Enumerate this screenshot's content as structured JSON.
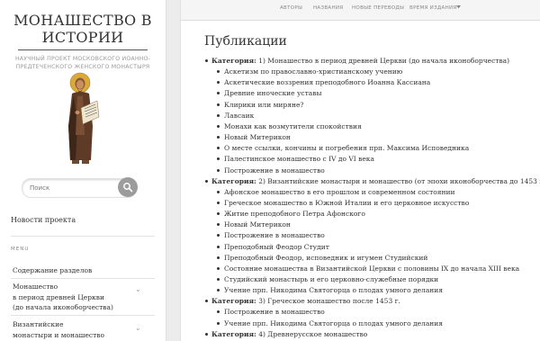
{
  "site": {
    "title_line1": "МОНАШЕСТВО В",
    "title_line2": "ИСТОРИИ",
    "description": "НАУЧНЫЙ ПРОЕКТ МОСКОВСКОГО ИОАННО-ПРЕДТЕЧЕНСКОГО ЖЕНСКОГО МОНАСТЫРЯ"
  },
  "search": {
    "placeholder": "Поиск"
  },
  "sidebar": {
    "news_link": "Новости проекта",
    "menu_label": "MENU",
    "menu_items": [
      "Содержание разделов",
      "Монашество\nв период древней Церкви\n(до начала иконоборчества)",
      "Византийские\nмонастыри и монашество"
    ]
  },
  "nav": {
    "items": [
      "АВТОРЫ",
      "НАЗВАНИЯ",
      "НОВЫЕ ПЕРЕВОДЫ",
      "ВРЕМЯ ИЗДАНИЯ"
    ],
    "dropdown_icon": "chevron-down-icon"
  },
  "page": {
    "title": "Публикации",
    "category_label": "Категория:",
    "categories": [
      {
        "name": "1) Монашество в период древней Церкви (до начала иконоборчества)",
        "items": [
          "Аскетизм по православно-христианскому учению",
          "Аскетические воззрения преподобного Иоанна Кассиана",
          "Древние иноческие уставы",
          "Клирики или миряне?",
          "Лавсаик",
          "Монахи как возмутители спокойствия",
          "Новый Митерикон",
          "О месте ссылки, кончины и погребения прп. Максима Исповедника",
          "Палестинское монашество с IV до VI века",
          "Построжение в монашество"
        ]
      },
      {
        "name": "2) Византийские монастыри и монашество (от эпохи иконоборчества до 1453 г.)",
        "items": [
          "Афонское монашество в его прошлом и современном состоянии",
          "Греческое монашество в Южной Италии и его церковное искусство",
          "Житие преподобного Петра Афонского",
          "Новый Митерикон",
          "Построжение в монашество",
          "Преподобный Феодор Студит",
          "Преподобный Феодор, исповедник и игумен Студийский",
          "Состояние монашества в Византийской Церкви с половины IX до начала XIII века",
          "Студийский монастырь и его церковно-служебные порядки",
          "Учение прп. Никодима Святогорца о плодах умного делания"
        ]
      },
      {
        "name": "3) Греческое монашество после 1453 г.",
        "items": [
          "Построжение в монашество",
          "Учение прп. Никодима Святогорца о плодах умного делания"
        ]
      },
      {
        "name": "4) Древнерусское монашество",
        "items": []
      }
    ]
  }
}
